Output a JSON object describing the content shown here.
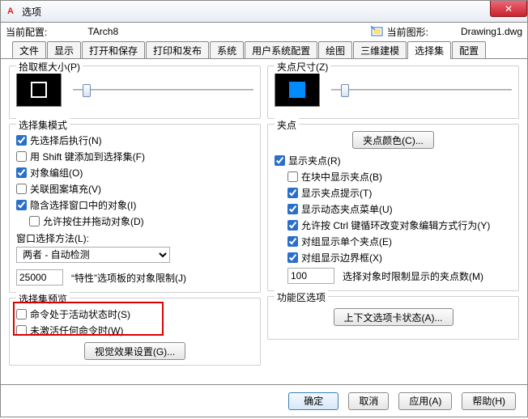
{
  "window": {
    "title": "选项",
    "close": "✕"
  },
  "config": {
    "current_label": "当前配置:",
    "current_value": "TArch8",
    "drawing_label": "当前图形:",
    "drawing_value": "Drawing1.dwg"
  },
  "tabs": [
    "文件",
    "显示",
    "打开和保存",
    "打印和发布",
    "系统",
    "用户系统配置",
    "绘图",
    "三维建模",
    "选择集",
    "配置"
  ],
  "active_tab": 8,
  "left": {
    "pickbox": {
      "title": "拾取框大小(P)"
    },
    "mode": {
      "title": "选择集模式",
      "items": [
        {
          "label": "先选择后执行(N)",
          "checked": true
        },
        {
          "label": "用 Shift 键添加到选择集(F)",
          "checked": false
        },
        {
          "label": "对象编组(O)",
          "checked": true
        },
        {
          "label": "关联图案填充(V)",
          "checked": false
        },
        {
          "label": "隐含选择窗口中的对象(I)",
          "checked": true
        },
        {
          "label": "允许按住并拖动对象(D)",
          "checked": false,
          "indent": true
        }
      ],
      "method_label": "窗口选择方法(L):",
      "method_value": "两者 - 自动检测",
      "limit_value": "25000",
      "limit_label": "“特性”选项板的对象限制(J)"
    },
    "preview": {
      "title": "选择集预览",
      "items": [
        {
          "label": "命令处于活动状态时(S)",
          "checked": false
        },
        {
          "label": "未激活任何命令时(W)",
          "checked": false
        }
      ],
      "btn": "视觉效果设置(G)..."
    }
  },
  "right": {
    "gripsize": {
      "title": "夹点尺寸(Z)"
    },
    "grips": {
      "title": "夹点",
      "color_btn": "夹点颜色(C)...",
      "items": [
        {
          "label": "显示夹点(R)",
          "checked": true
        },
        {
          "label": "在块中显示夹点(B)",
          "checked": false,
          "indent": true
        },
        {
          "label": "显示夹点提示(T)",
          "checked": true,
          "indent": true
        },
        {
          "label": "显示动态夹点菜单(U)",
          "checked": true,
          "indent": true
        },
        {
          "label": "允许按 Ctrl 键循环改变对象编辑方式行为(Y)",
          "checked": true,
          "indent": true
        },
        {
          "label": "对组显示单个夹点(E)",
          "checked": true,
          "indent": true
        },
        {
          "label": "对组显示边界框(X)",
          "checked": true,
          "indent": true,
          "indent2": true
        }
      ],
      "limit_value": "100",
      "limit_label": "选择对象时限制显示的夹点数(M)"
    },
    "ribbon": {
      "title": "功能区选项",
      "btn": "上下文选项卡状态(A)..."
    }
  },
  "buttons": {
    "ok": "确定",
    "cancel": "取消",
    "apply": "应用(A)",
    "help": "帮助(H)"
  }
}
